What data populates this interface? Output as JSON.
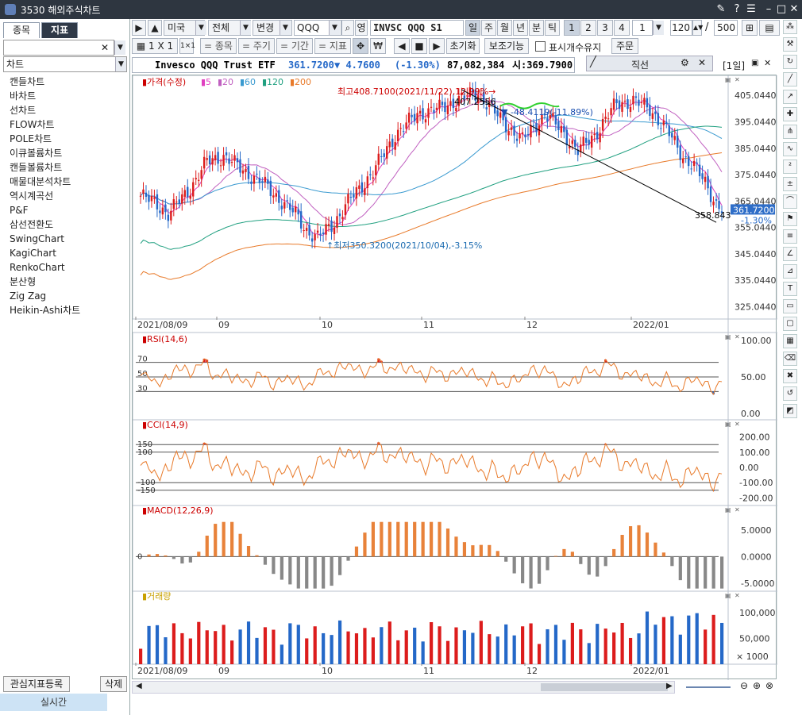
{
  "window": {
    "title": "3530 해외주식차트"
  },
  "left": {
    "tabs": [
      "종목",
      "지표"
    ],
    "combo": "차트",
    "items": [
      "캔들차트",
      "바차트",
      "선차트",
      "FLOW차트",
      "POLE차트",
      "이큐볼륨차트",
      "캔들볼륨차트",
      "매물대분석차트",
      "역시계곡선",
      "P&F",
      "삼선전환도",
      "SwingChart",
      "KagiChart",
      "RenkoChart",
      "분산형",
      "Zig Zag",
      "Heikin-Ashi차트"
    ],
    "btn_register": "관심지표등록",
    "btn_delete": "삭제",
    "realtime": "실시간"
  },
  "toolbar1": {
    "market": "미국",
    "all": "전체",
    "change": "변경",
    "symbol": "QQQ",
    "eng": "영",
    "symbol_name": "INVSC QQQ S1",
    "periods": [
      "일",
      "주",
      "월",
      "년",
      "분",
      "틱"
    ],
    "nums": [
      "1",
      "2",
      "3",
      "4"
    ],
    "count_sel": "1",
    "count": "120",
    "total": "500"
  },
  "toolbar2": {
    "layout": "1 X 1",
    "b1": "= 종목",
    "b2": "= 주기",
    "b3": "= 기간",
    "b4": "= 지표",
    "reset": "초기화",
    "aux": "보조기능",
    "checkbox": "표시개수유지",
    "order": "주문"
  },
  "info": {
    "name": "Invesco QQQ Trust ETF",
    "price": "361.7200",
    "change": "▼ 4.7600",
    "pct": "(-1.30%)",
    "volume": "87,082,384",
    "open": "시:369.7900",
    "line_tool": "직선",
    "period_label": "[1일]"
  },
  "colors": {
    "up": "#dc1c1c",
    "down": "#2468c8",
    "ma5": "#e040c0",
    "ma20": "#c060c0",
    "ma60": "#3a9ad0",
    "ma120": "#20a080",
    "ma200": "#e87a2a",
    "accent": "#2f3947"
  },
  "chart_data": [
    {
      "type": "candlestick",
      "title": "가격(수정)",
      "legend": [
        "5",
        "20",
        "60",
        "120",
        "200"
      ],
      "y_ticks": [
        "405.0440",
        "395.0440",
        "385.0440",
        "375.0440",
        "365.0440",
        "355.0440",
        "345.0440",
        "335.0440",
        "325.0440"
      ],
      "ylim": [
        321,
        412
      ],
      "x_ticks": [
        "2021/08/09",
        "09",
        "10",
        "11",
        "12",
        "2022/01"
      ],
      "annotations": [
        "최고408.7100(2021/11/22),12.99%",
        "407.2556",
        "-48.4119(-11.89%)",
        "358.843",
        "최저350.3200(2021/10/04),-3.15%"
      ],
      "last": "361.7200",
      "last_pct": "-1.30%"
    },
    {
      "type": "area",
      "title": "RSI(14,6)",
      "y_ticks": [
        "100.00",
        "50.00",
        "0.00"
      ],
      "levels": [
        "70",
        "50",
        "30"
      ],
      "ylim": [
        0,
        100
      ]
    },
    {
      "type": "line",
      "title": "CCI(14,9)",
      "y_ticks": [
        "200.00",
        "100.00",
        "0.00",
        "-100.00",
        "-200.00"
      ],
      "levels": [
        "150",
        "100",
        "-100",
        "-150"
      ],
      "ylim": [
        -250,
        250
      ]
    },
    {
      "type": "bar",
      "title": "MACD(12,26,9)",
      "y_ticks": [
        "5.0000",
        "0.0000",
        "-5.0000"
      ],
      "ylim": [
        -6.5,
        7.5
      ]
    },
    {
      "type": "bar",
      "title": "거래량",
      "y_ticks": [
        "100,000",
        "50,000",
        "× 1000"
      ],
      "ylim": [
        0,
        120000
      ]
    }
  ]
}
